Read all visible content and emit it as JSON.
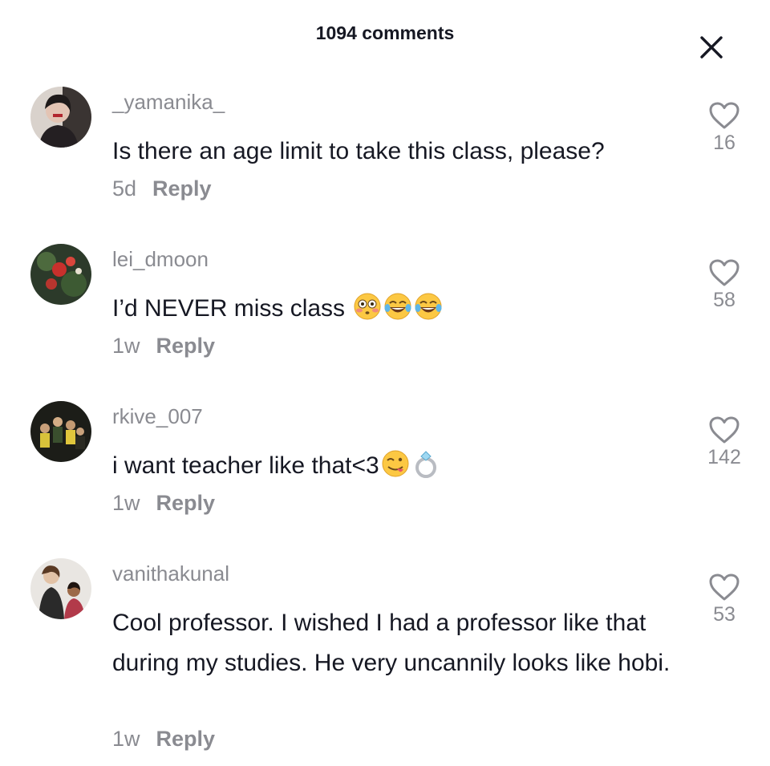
{
  "header": {
    "title": "1094 comments"
  },
  "icons": {
    "close": "close-icon",
    "like": "heart-outline-icon"
  },
  "comments": [
    {
      "username": "_yamanika_",
      "text": "Is there an age limit to take this class, please?",
      "emojis": [],
      "age": "5d",
      "reply_label": "Reply",
      "likes": "16"
    },
    {
      "username": "lei_dmoon",
      "text": "I’d NEVER miss class ",
      "emojis": [
        "flushed-face-emoji",
        "tears-of-joy-emoji",
        "tears-of-joy-emoji"
      ],
      "age": "1w",
      "reply_label": "Reply",
      "likes": "58"
    },
    {
      "username": "rkive_007",
      "text": "i want teacher like that<3",
      "emojis": [
        "face-savoring-food-emoji",
        "ring-emoji"
      ],
      "age": "1w",
      "reply_label": "Reply",
      "likes": "142"
    },
    {
      "username": "vanithakunal",
      "text": "Cool professor. I wished I had a professor like that during my studies. He very uncannily looks like hobi.",
      "emojis": [],
      "age": "1w",
      "reply_label": "Reply",
      "likes": "53"
    }
  ]
}
